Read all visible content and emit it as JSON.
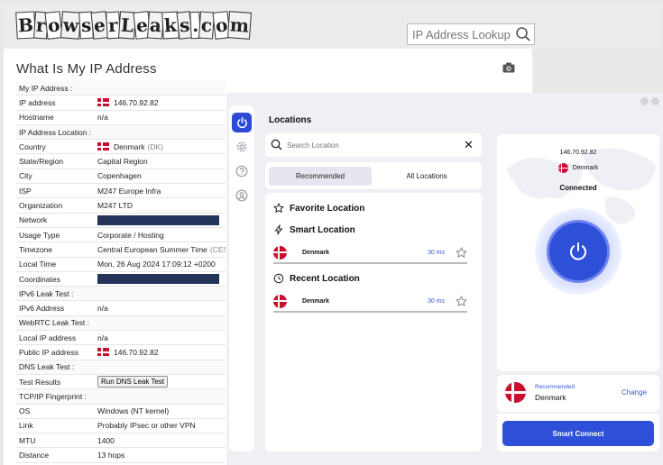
{
  "site": {
    "logo_text": "BrowserLeaks.com",
    "search_placeholder": "IP Address Lookup",
    "page_title": "What Is My IP Address"
  },
  "ip_table": {
    "my_ip_section": "My IP Address :",
    "ip_address_label": "IP address",
    "ip_address_value": "146.70.92.82",
    "hostname_label": "Hostname",
    "hostname_value": "n/a",
    "location_section": "IP Address Location :",
    "country_label": "Country",
    "country_value": "Denmark",
    "country_code": "(DK)",
    "state_label": "State/Region",
    "state_value": "Capital Region",
    "city_label": "City",
    "city_value": "Copenhagen",
    "isp_label": "ISP",
    "isp_value": "M247 Europe Infra",
    "org_label": "Organization",
    "org_value": "M247 LTD",
    "network_label": "Network",
    "usage_label": "Usage Type",
    "usage_value": "Corporate / Hosting",
    "timezone_label": "Timezone",
    "timezone_value": "Central European Summer Time",
    "timezone_suffix": "(CES",
    "localtime_label": "Local Time",
    "localtime_value": "Mon, 26 Aug 2024 17:09:12 +0200",
    "coords_label": "Coordinates",
    "ipv6_section": "IPv6 Leak Test :",
    "ipv6_label": "IPv6 Address",
    "ipv6_value": "n/a",
    "webrtc_section": "WebRTC Leak Test :",
    "local_ip_label": "Local IP address",
    "local_ip_value": "n/a",
    "public_ip_label": "Public IP address",
    "public_ip_value": "146.70.92.82",
    "dns_section": "DNS Leak Test :",
    "test_results_label": "Test Results",
    "dns_button": "Run DNS Leak Test",
    "tcp_section": "TCP/IP Fingerprint :",
    "os_label": "OS",
    "os_value": "Windows (NT kernel)",
    "link_label": "Link",
    "link_value": "Probably IPsec or other VPN",
    "mtu_label": "MTU",
    "mtu_value": "1400",
    "distance_label": "Distance",
    "distance_value": "13 hops"
  },
  "vpn": {
    "locations_title": "Locations",
    "search_placeholder": "Search Location",
    "tab_recommended": "Recommended",
    "tab_all": "All Locations",
    "favorite_title": "Favorite Location",
    "smart_title": "Smart Location",
    "recent_title": "Recent Location",
    "smart_item": {
      "name": "Denmark",
      "ping": "30 ms"
    },
    "recent_item": {
      "name": "Denmark",
      "ping": "30 ms"
    },
    "status_ip": "146.70.92.82",
    "status_country": "Denmark",
    "status_text": "Connected",
    "reco_label": "Recommended",
    "reco_country": "Denmark",
    "change_label": "Change",
    "smart_connect": "Smart Connect"
  },
  "colors": {
    "accent": "#2e4fd8",
    "danish_red": "#c8102e",
    "redaction": "#24345a"
  },
  "icons": [
    "search-icon",
    "camera-icon",
    "power-icon",
    "gear-icon",
    "help-icon",
    "user-icon",
    "star-icon",
    "lightning-icon",
    "clock-icon",
    "close-icon"
  ]
}
